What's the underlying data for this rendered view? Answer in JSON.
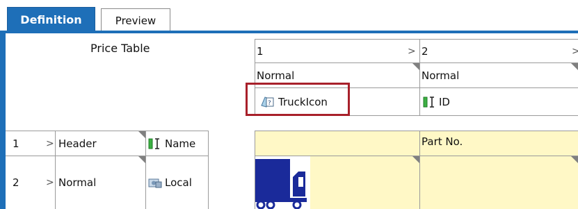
{
  "tabs": [
    {
      "label": "Definition",
      "active": true
    },
    {
      "label": "Preview",
      "active": false
    }
  ],
  "table": {
    "title": "Price Table",
    "columns": [
      {
        "index": "1",
        "style": "Normal",
        "field": "TruckIcon",
        "field_icon": "image-field-icon"
      },
      {
        "index": "2",
        "style": "Normal",
        "field": "ID",
        "field_icon": "text-field-icon"
      }
    ],
    "rows": [
      {
        "index": "1",
        "style": "Header",
        "field": "Name",
        "field_icon": "text-field-icon",
        "cells": [
          "",
          "Part No."
        ]
      },
      {
        "index": "2",
        "style": "Normal",
        "field": "Local",
        "field_icon": "local-field-icon",
        "cells": [
          "[truck-image]",
          ""
        ]
      }
    ]
  },
  "colors": {
    "accent": "#1e6fb8",
    "highlight": "#a8202a",
    "cell_yellow": "#fff8c6"
  }
}
